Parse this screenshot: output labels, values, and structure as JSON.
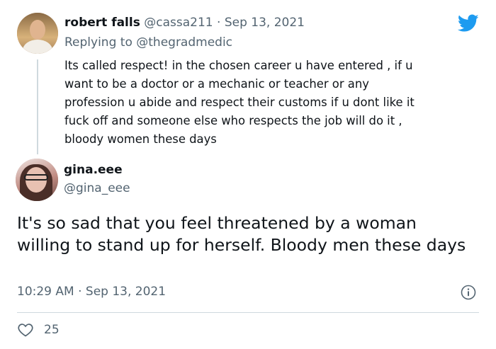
{
  "reply_tweet": {
    "author_name": "robert falls",
    "author_handle": "@cassa211",
    "separator": "·",
    "date": "Sep 13, 2021",
    "replying_prefix": "Replying to",
    "replying_to": "@thegradmedic",
    "text": "Its called respect! in the chosen career u have entered , if u\nwant to be a doctor or a mechanic or  teacher or any\nprofession  u abide and respect their customs if u dont like it\nfuck off and someone else who respects the job will do it ,\nbloody women these days"
  },
  "main_tweet": {
    "author_name": "gina.eee",
    "author_handle": "@gina_eee",
    "text": "It's so sad that you feel threatened by a woman willing to stand up for herself. Bloody men these days",
    "timestamp": "10:29 AM · Sep 13, 2021",
    "like_count": "25"
  },
  "icons": {
    "brand": "twitter-bird-icon",
    "info": "info-icon",
    "like": "heart-icon"
  },
  "colors": {
    "brand": "#1d9bf0",
    "text": "#0f1419",
    "muted": "#536471",
    "divider": "#cfd9de"
  }
}
